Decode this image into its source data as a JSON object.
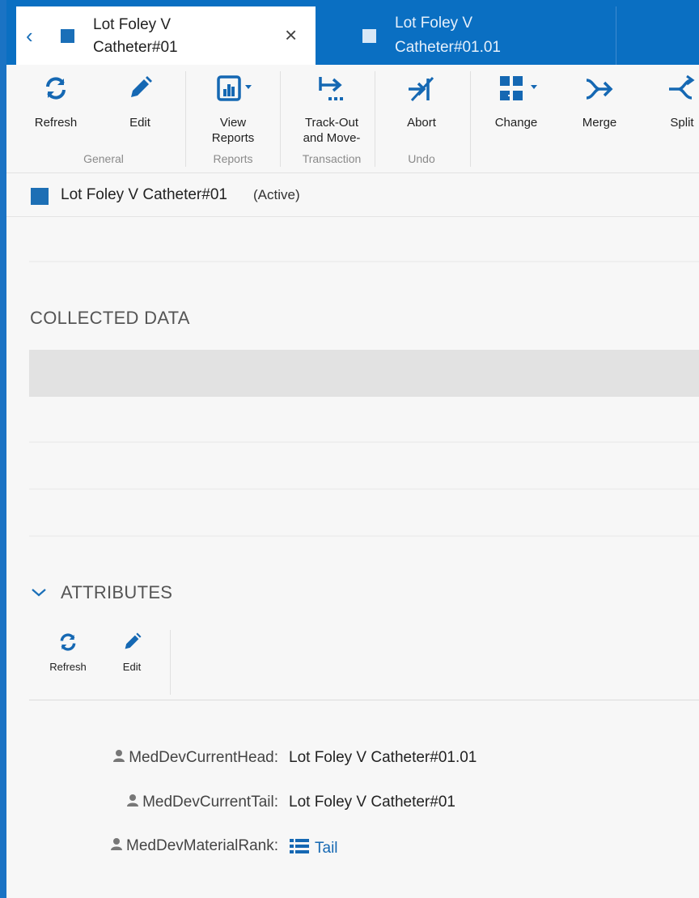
{
  "tabs": [
    {
      "label_line1": "Lot Foley V",
      "label_line2": "Catheter#01",
      "active": true
    },
    {
      "label_line1": "Lot Foley V",
      "label_line2": "Catheter#01.01",
      "active": false
    }
  ],
  "toolbar": {
    "buttons": [
      {
        "id": "refresh",
        "label": "Refresh",
        "icon": "refresh-icon"
      },
      {
        "id": "edit",
        "label": "Edit",
        "icon": "pencil-icon"
      },
      {
        "id": "view_reports",
        "label_line1": "View",
        "label_line2": "Reports",
        "icon": "report-chart-icon"
      },
      {
        "id": "track_out",
        "label_line1": "Track-Out",
        "label_line2": "and Move-",
        "icon": "track-out-icon"
      },
      {
        "id": "abort",
        "label": "Abort",
        "icon": "abort-icon"
      },
      {
        "id": "change",
        "label": "Change",
        "icon": "change-icon"
      },
      {
        "id": "merge",
        "label": "Merge",
        "icon": "merge-icon"
      },
      {
        "id": "split",
        "label": "Split",
        "icon": "split-icon"
      }
    ],
    "groups": {
      "general": "General",
      "reports": "Reports",
      "transaction": "Transaction",
      "undo": "Undo"
    }
  },
  "lot": {
    "title": "Lot Foley V Catheter#01",
    "status": "(Active)"
  },
  "sections": {
    "collected_data": "COLLECTED DATA",
    "attributes": "ATTRIBUTES"
  },
  "attributes_toolbar": {
    "refresh": "Refresh",
    "edit": "Edit"
  },
  "attributes": [
    {
      "key": "MedDevCurrentHead:",
      "value": "Lot Foley V Catheter#01.01"
    },
    {
      "key": "MedDevCurrentTail:",
      "value": "Lot Foley V Catheter#01"
    },
    {
      "key": "MedDevMaterialRank:",
      "value": "Tail"
    }
  ],
  "colors": {
    "accent": "#0a6fc2",
    "icon_blue": "#1568b3"
  }
}
